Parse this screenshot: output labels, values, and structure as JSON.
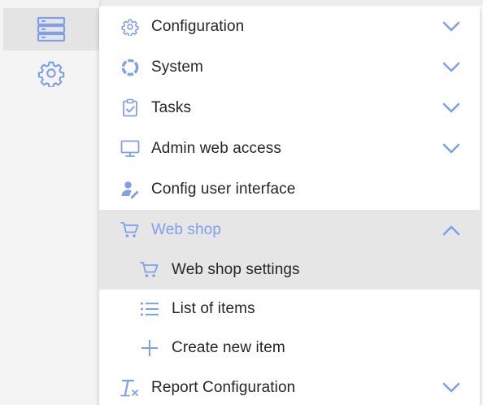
{
  "colors": {
    "accent": "#7fa0e8",
    "text": "#262626",
    "active_row": "#e6e6e6"
  },
  "rail": {
    "items": [
      {
        "icon": "server-icon",
        "active": true
      },
      {
        "icon": "gear-icon",
        "active": false
      }
    ]
  },
  "menu": {
    "items": [
      {
        "label": "Configuration",
        "icon": "gear-icon",
        "chevron": "down"
      },
      {
        "label": "System",
        "icon": "ring-icon",
        "chevron": "down"
      },
      {
        "label": "Tasks",
        "icon": "clipboard-check-icon",
        "chevron": "down"
      },
      {
        "label": "Admin web access",
        "icon": "monitor-icon",
        "chevron": "down"
      },
      {
        "label": "Config user interface",
        "icon": "user-edit-icon",
        "chevron": "none"
      },
      {
        "label": "Web shop",
        "icon": "cart-icon",
        "chevron": "up",
        "expanded": true,
        "children": [
          {
            "label": "Web shop settings",
            "icon": "cart-icon",
            "selected": true
          },
          {
            "label": "List of items",
            "icon": "list-icon"
          },
          {
            "label": "Create new item",
            "icon": "plus-icon"
          }
        ]
      },
      {
        "label": "Report Configuration",
        "icon": "clear-format-icon",
        "chevron": "down"
      }
    ]
  }
}
